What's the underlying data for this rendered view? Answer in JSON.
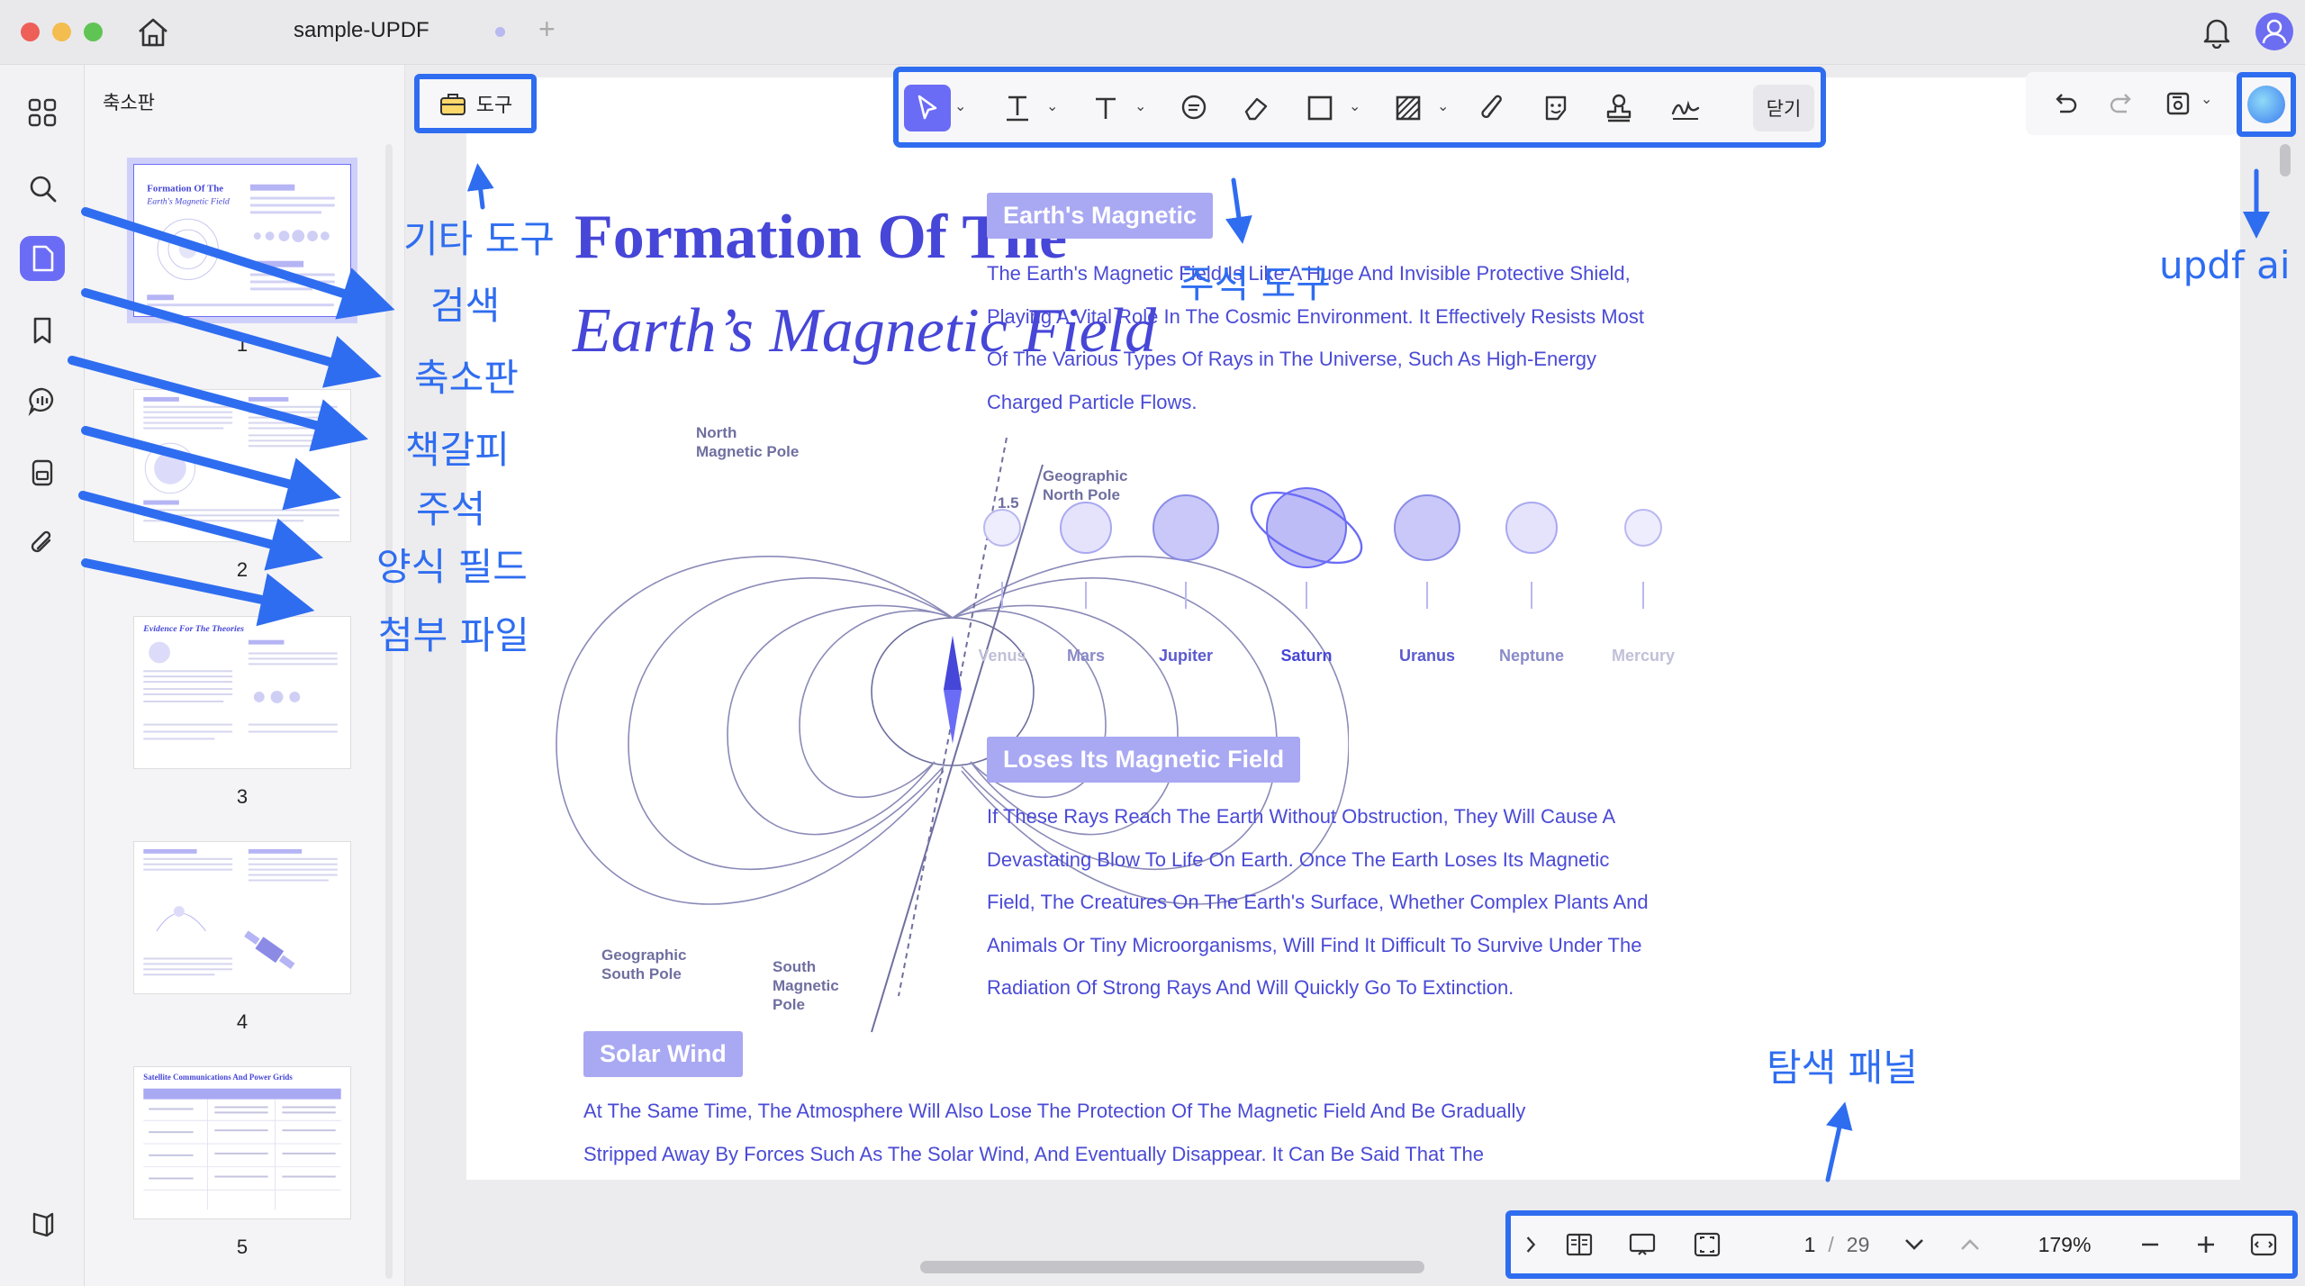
{
  "window": {
    "tab_title": "sample-UPDF",
    "icons": [
      "home-icon",
      "bell-icon",
      "user-avatar-icon",
      "plus-icon"
    ]
  },
  "sidebar": {
    "title": "축소판",
    "rail_icons": [
      "grid-icon",
      "search-icon",
      "thumbnail-icon",
      "bookmark-icon",
      "comment-icon",
      "form-icon",
      "attachment-icon",
      "layers-icon"
    ],
    "pages": [
      "1",
      "2",
      "3",
      "4",
      "5"
    ]
  },
  "toolbar": {
    "tool_button_label": "도구",
    "close_label": "닫기",
    "annotation_tools": [
      "select",
      "text-highlight",
      "text",
      "note",
      "eraser",
      "shape",
      "area",
      "attachment",
      "sticker",
      "stamp",
      "signature"
    ]
  },
  "nav": {
    "current_page": "1",
    "separator": "/",
    "total_pages": "29",
    "zoom": "179%"
  },
  "document": {
    "title_line1": "Formation Of The",
    "title_line2": "Earth’s Magnetic Field",
    "section1": {
      "tag": "Earth's Magnetic",
      "lines": [
        "The Earth's Magnetic Field Is Like A Huge And Invisible Protective Shield,",
        "Playing A Vital Role In The Cosmic Environment. It Effectively Resists Most",
        "Of The Various Types Of Rays in The Universe, Such As High-Energy",
        "Charged Particle Flows."
      ]
    },
    "planets": [
      "Venus",
      "Mars",
      "Jupiter",
      "Saturn",
      "Uranus",
      "Neptune",
      "Mercury"
    ],
    "diagram_labels": {
      "north_magnetic": "North Magnetic Pole",
      "north_magnetic_l1": "North",
      "north_magnetic_l2": "Magnetic Pole",
      "geo_north_l1": "Geographic",
      "geo_north_l2": "North Pole",
      "angle": "1.5",
      "geo_south_l1": "Geographic",
      "geo_south_l2": "South Pole",
      "south_mag_l1": "South",
      "south_mag_l2": "Magnetic",
      "south_mag_l3": "Pole"
    },
    "section2": {
      "tag": "Loses Its Magnetic Field",
      "lines": [
        "If These Rays Reach The Earth Without Obstruction, They Will Cause A",
        "Devastating Blow To Life On Earth. Once The Earth Loses Its Magnetic",
        "Field, The Creatures On The Earth's Surface, Whether Complex Plants And",
        "Animals Or Tiny Microorganisms, Will Find It Difficult To Survive Under The",
        "Radiation Of Strong Rays And Will Quickly Go To Extinction."
      ]
    },
    "section3": {
      "tag": "Solar Wind",
      "lines": [
        "At The Same Time, The Atmosphere Will Also Lose The Protection Of The Magnetic Field And Be Gradually",
        "Stripped Away By Forces Such As The Solar Wind, And Eventually Disappear. It Can Be Said That The"
      ]
    }
  },
  "annotations": {
    "other_tools": "기타 도구",
    "search": "검색",
    "thumbnails": "축소판",
    "bookmarks": "책갈피",
    "comments": "주석",
    "form_fields": "양식 필드",
    "attachments": "첨부 파일",
    "annotation_tools": "주석 도구",
    "updf_ai": "updf ai",
    "nav_panel": "탐색 패널"
  },
  "colors": {
    "accent": "#6b6cf5",
    "annotation_blue": "#2f6df0",
    "doc_text": "#4646d8",
    "tag_bg": "#a9a8f2"
  }
}
